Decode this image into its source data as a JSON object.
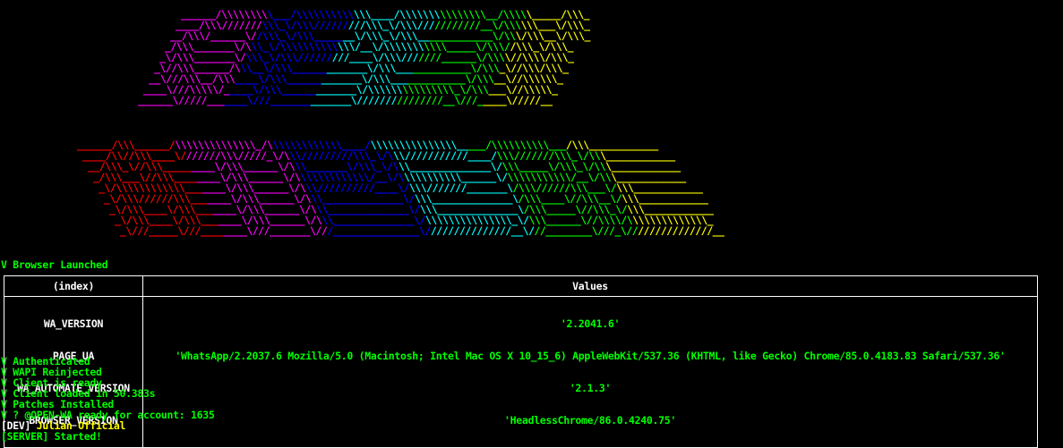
{
  "banner": {
    "colors": [
      "#ff00ff",
      "#0000ff",
      "#00ffff",
      "#00ff00",
      "#ffff00"
    ],
    "colors2": [
      "#ff0000",
      "#ff00ff",
      "#0000ff",
      "#00ffff",
      "#00ff00",
      "#ffff00"
    ]
  },
  "logs_top": {
    "browser_launched": "V Browser Launched"
  },
  "table": {
    "header_index": "(index)",
    "header_values": "Values",
    "keys": [
      "WA_VERSION",
      "PAGE_UA",
      "WA_AUTOMATE_VERSION",
      "BROWSER_VERSION"
    ],
    "values": [
      "'2.2041.6'",
      "'WhatsApp/2.2037.6 Mozilla/5.0 (Macintosh; Intel Mac OS X 10_15_6) AppleWebKit/537.36 (KHTML, like Gecko) Chrome/85.0.4183.83 Safari/537.36'",
      "'2.1.3'",
      "'HeadlessChrome/86.0.4240.75'"
    ]
  },
  "logs_bottom": {
    "authenticated": "V Authenticated",
    "wapi": "V WAPI Reinjected",
    "ready": "V Client is ready",
    "loaded": "V Client loaded in 50.383s",
    "patches": "V Patches Installed",
    "open_wa": "V ? @OPEN-WA ready for account: 1635",
    "dev_tag": "[DEV]",
    "dev_name": " Julian Official",
    "server": "[SERVER] Started!"
  }
}
